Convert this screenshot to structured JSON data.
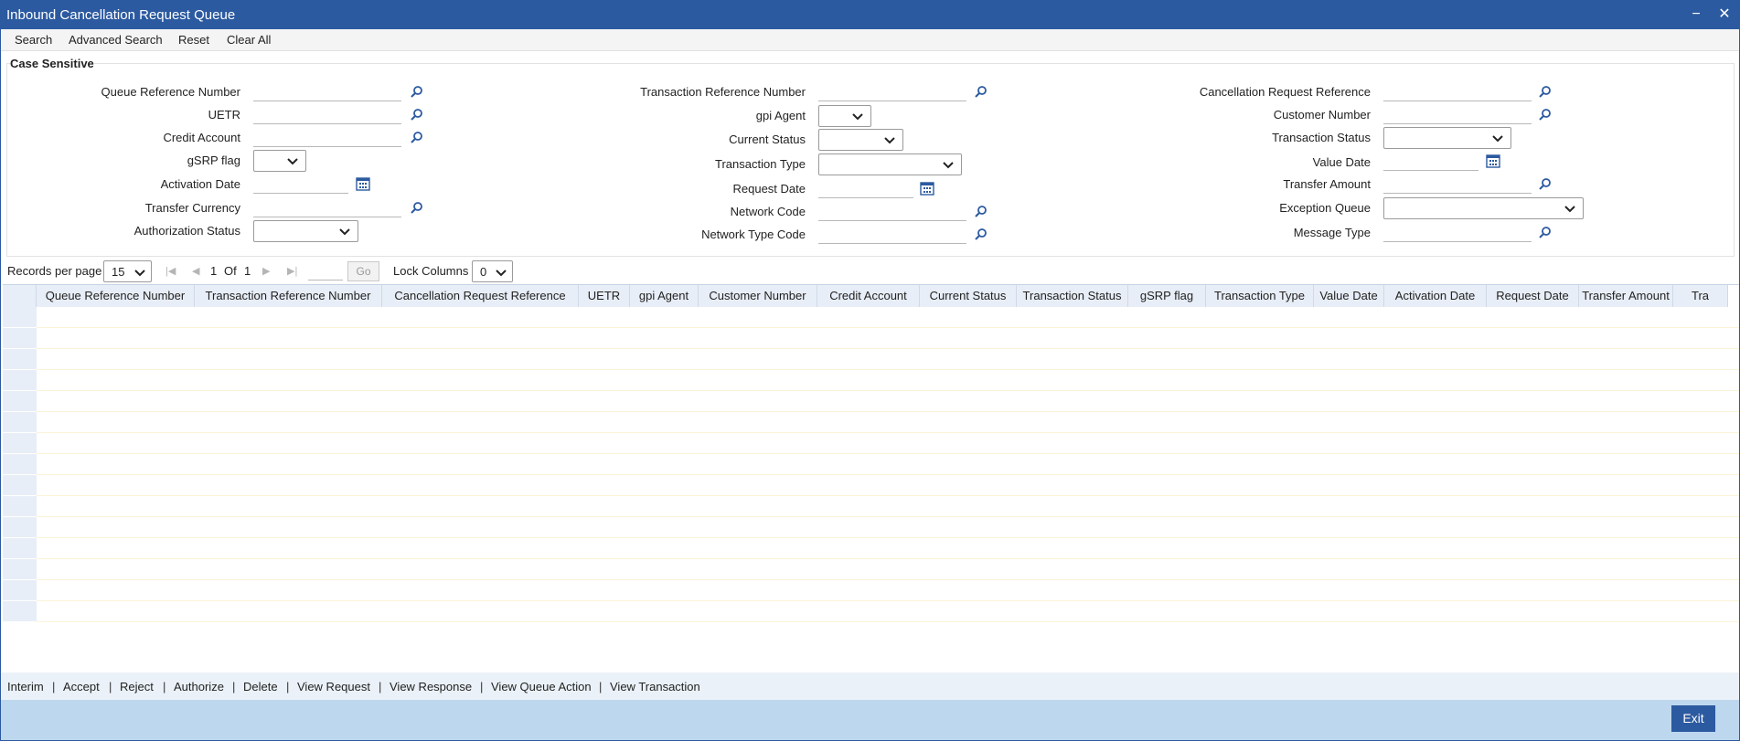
{
  "window": {
    "title": "Inbound Cancellation Request Queue",
    "minimize": "−",
    "close": "✕"
  },
  "menu": {
    "search": "Search",
    "advanced_search": "Advanced Search",
    "reset": "Reset",
    "clear_all": "Clear All"
  },
  "section": {
    "legend": "Case Sensitive"
  },
  "fields": {
    "queue_reference_number": "Queue Reference Number",
    "uetr": "UETR",
    "credit_account": "Credit Account",
    "gsrp_flag": "gSRP flag",
    "activation_date": "Activation Date",
    "transfer_currency": "Transfer Currency",
    "authorization_status": "Authorization Status",
    "transaction_reference_number": "Transaction Reference Number",
    "gpi_agent": "gpi Agent",
    "current_status": "Current Status",
    "transaction_type": "Transaction Type",
    "request_date": "Request Date",
    "network_code": "Network Code",
    "network_type_code": "Network Type Code",
    "cancellation_request_reference": "Cancellation Request Reference",
    "customer_number": "Customer Number",
    "transaction_status": "Transaction Status",
    "value_date": "Value Date",
    "transfer_amount": "Transfer Amount",
    "exception_queue": "Exception Queue",
    "message_type": "Message Type"
  },
  "pager": {
    "records_per_page_label": "Records per page",
    "records_per_page": "15",
    "current_page": "1",
    "of_label": "Of",
    "total_pages": "1",
    "go": "Go",
    "lock_columns_label": "Lock Columns",
    "lock_columns": "0"
  },
  "grid": {
    "columns": [
      "Queue Reference Number",
      "Transaction Reference Number",
      "Cancellation Request Reference",
      "UETR",
      "gpi Agent",
      "Customer Number",
      "Credit Account",
      "Current Status",
      "Transaction Status",
      "gSRP flag",
      "Transaction Type",
      "Value Date",
      "Activation Date",
      "Request Date",
      "Transfer Amount",
      "Tra"
    ]
  },
  "actions": [
    "Interim",
    "Accept",
    "Reject",
    "Authorize",
    "Delete",
    "View Request",
    "View Response",
    "View Queue Action",
    "View Transaction"
  ],
  "footer": {
    "exit": "Exit"
  },
  "colors": {
    "title_bar": "#2c5aa0",
    "footer": "#bdd7ee",
    "header_row": "#e8eef7",
    "icon": "#2c5aa0"
  }
}
